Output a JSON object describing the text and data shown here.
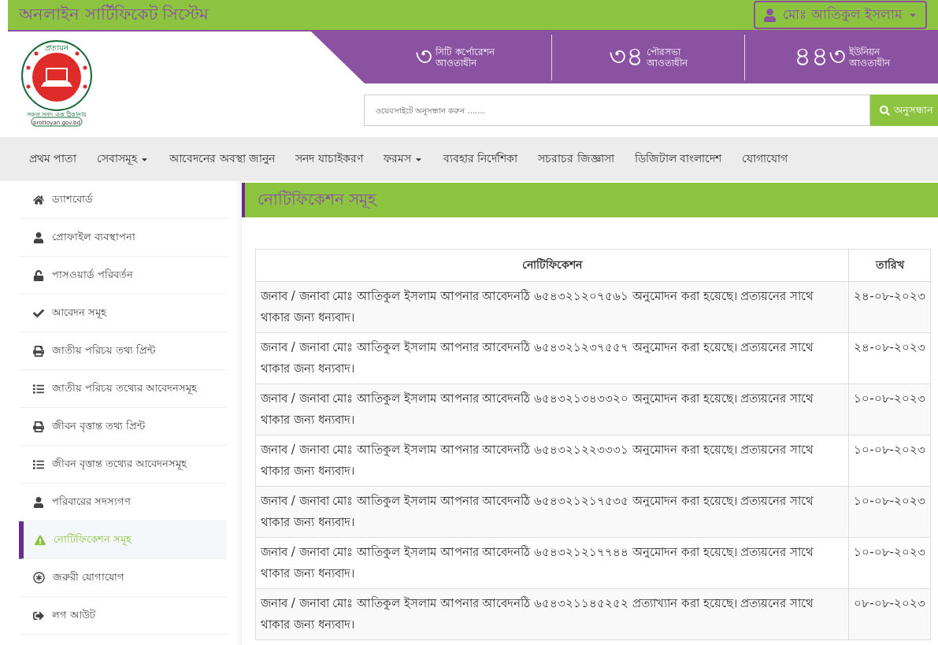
{
  "topbar": {
    "title": "অনলাইন সার্টিফিকেট সিস্টেম",
    "user_menu": "মোঃ আতিকুল ইসলাম"
  },
  "logo": {
    "top_text": "প্রত্যয়ন",
    "bottom_text": "সকল সনদ এক ঠিকানায়",
    "url": "prottoyan.gov.bd"
  },
  "stats": [
    {
      "number": "৩",
      "line1": "সিটি কর্পোরেশন",
      "line2": "আওতাধীন"
    },
    {
      "number": "৩৪",
      "line1": "পৌরসভা",
      "line2": "আওতাধীন"
    },
    {
      "number": "৪৪৩",
      "line1": "ইউনিয়ন",
      "line2": "আওতাধীন"
    }
  ],
  "search": {
    "placeholder": "ওয়েবসাইটে অনুসন্ধান করুন .......",
    "button": "অনুসন্ধান"
  },
  "nav": [
    {
      "label": "প্রথম পাতা",
      "dropdown": false
    },
    {
      "label": "সেবাসমূহ",
      "dropdown": true
    },
    {
      "label": "আবেদনের অবস্থা জানুন",
      "dropdown": false
    },
    {
      "label": "সনদ যাচাইকরণ",
      "dropdown": false
    },
    {
      "label": "ফরমস",
      "dropdown": true
    },
    {
      "label": "ব্যবহার নির্দেশিকা",
      "dropdown": false
    },
    {
      "label": "সচরাচর জিজ্ঞাসা",
      "dropdown": false
    },
    {
      "label": "ডিজিটাল বাংলাদেশ",
      "dropdown": false
    },
    {
      "label": "যোগাযোগ",
      "dropdown": false
    }
  ],
  "sidebar": {
    "items": [
      {
        "label": "ড্যাশবোর্ড",
        "kind": "home",
        "selected": false
      },
      {
        "label": "প্রোফাইল ব্যবস্থাপনা",
        "kind": "user",
        "selected": false
      },
      {
        "label": "পাসওয়ার্ড পরিবর্তন",
        "kind": "lock",
        "selected": false
      },
      {
        "label": "আবেদন সমূহ",
        "kind": "check",
        "selected": false
      },
      {
        "label": "জাতীয় পরিচয় তথ্য প্রিন্ট",
        "kind": "print",
        "selected": false
      },
      {
        "label": "জাতীয় পরিচয় তথ্যের আবেদনসমূহ",
        "kind": "list",
        "selected": false
      },
      {
        "label": "জীবন বৃত্তান্ত তথ্য প্রিন্ট",
        "kind": "print",
        "selected": false
      },
      {
        "label": "জীবন বৃত্তান্ত তথ্যের আবেদনসমূহ",
        "kind": "list",
        "selected": false
      },
      {
        "label": "পরিবারের সদস্যগণ",
        "kind": "user",
        "selected": false
      },
      {
        "label": "নোটিফিকেশন সমূহ",
        "kind": "warning",
        "selected": true
      },
      {
        "label": "জরুরী যোগাযোগ",
        "kind": "asterisk",
        "selected": false
      },
      {
        "label": "লগ আউট",
        "kind": "logout",
        "selected": false
      }
    ]
  },
  "content": {
    "title": "নোটিফিকেশন সমূহ",
    "table": {
      "columns": [
        "নোটিফিকেশন",
        "তারিখ"
      ],
      "rows": [
        [
          "জনাব / জনাবা মোঃ আতিকুল ইসলাম আপনার আবেদনঠি ৬৫৪৩২১২০৭৫৬১ অনুমোদন করা হয়েছে। প্রত্যয়নের সাথে থাকার জন্য ধন্যবাদ।",
          "২৪-০৮-২০২৩"
        ],
        [
          "জনাব / জনাবা মোঃ আতিকুল ইসলাম আপনার আবেদনঠি ৬৫৪৩২১২৩৭৫৫৭ অনুমোদন করা হয়েছে। প্রত্যয়নের সাথে থাকার জন্য ধন্যবাদ।",
          "২৪-০৮-২০২৩"
        ],
        [
          "জনাব / জনাবা মোঃ আতিকুল ইসলাম আপনার আবেদনঠি ৬৫৪৩২১৩৪৩৩২০ অনুমোদন করা হয়েছে। প্রত্যয়নের সাথে থাকার জন্য ধন্যবাদ।",
          "১০-০৮-২০২৩"
        ],
        [
          "জনাব / জনাবা মোঃ আতিকুল ইসলাম আপনার আবেদনঠি ৬৫৪৩২১২২৩৩৩১ অনুমোদন করা হয়েছে। প্রত্যয়নের সাথে থাকার জন্য ধন্যবাদ।",
          "১০-০৮-২০২৩"
        ],
        [
          "জনাব / জনাবা মোঃ আতিকুল ইসলাম আপনার আবেদনঠি ৬৫৪৩২১২১৭৫৩৫ অনুমোদন করা হয়েছে। প্রত্যয়নের সাথে থাকার জন্য ধন্যবাদ।",
          "১০-০৮-২০২৩"
        ],
        [
          "জনাব / জনাবা মোঃ আতিকুল ইসলাম আপনার আবেদনঠি ৬৫৪৩২১২১৭৭৪৪ অনুমোদন করা হয়েছে। প্রত্যয়নের সাথে থাকার জন্য ধন্যবাদ।",
          "১০-০৮-২০২৩"
        ],
        [
          "জনাব / জনাবা মোঃ আতিকুল ইসলাম আপনার আবেদনঠি ৬৫৪৩২১১৪৫২৫২ প্রত্যাখ্যান করা হয়েছে। প্রত্যয়নের সাথে থাকার জন্য ধন্যবাদ।",
          "০৮-০৮-২০২৩"
        ]
      ]
    }
  }
}
